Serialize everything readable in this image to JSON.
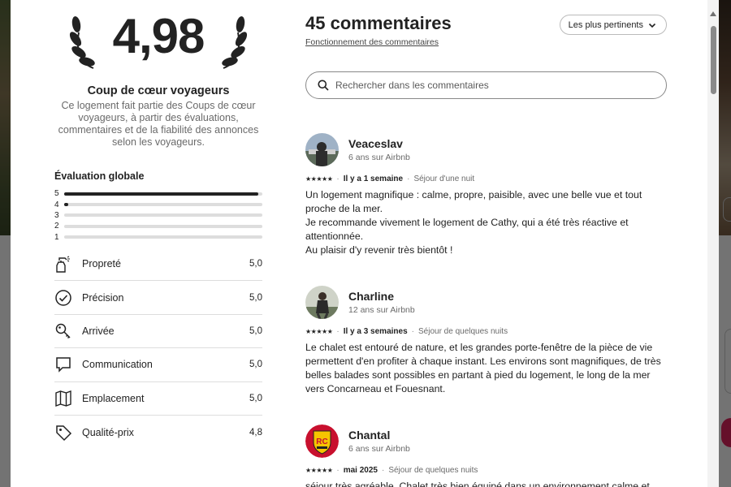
{
  "hero": {
    "score": "4,98",
    "title": "Coup de cœur voyageurs",
    "description": "Ce logement fait partie des Coups de cœur voyageurs, à partir des évaluations, commentaires et de la fiabilité des annonces selon les voyageurs."
  },
  "overall": {
    "title": "Évaluation globale",
    "distribution": [
      {
        "stars": "5",
        "fraction": 0.98
      },
      {
        "stars": "4",
        "fraction": 0.02
      },
      {
        "stars": "3",
        "fraction": 0
      },
      {
        "stars": "2",
        "fraction": 0
      },
      {
        "stars": "1",
        "fraction": 0
      }
    ]
  },
  "categories": [
    {
      "label": "Propreté",
      "value": "5,0",
      "icon": "spray-bottle-icon"
    },
    {
      "label": "Précision",
      "value": "5,0",
      "icon": "check-circle-icon"
    },
    {
      "label": "Arrivée",
      "value": "5,0",
      "icon": "key-icon"
    },
    {
      "label": "Communication",
      "value": "5,0",
      "icon": "chat-bubble-icon"
    },
    {
      "label": "Emplacement",
      "value": "5,0",
      "icon": "map-icon"
    },
    {
      "label": "Qualité-prix",
      "value": "4,8",
      "icon": "tag-icon"
    }
  ],
  "reviews_header": {
    "count_title": "45 commentaires",
    "how_link": "Fonctionnement des commentaires",
    "sort_label": "Les plus pertinents",
    "search_placeholder": "Rechercher dans les commentaires"
  },
  "reviews": [
    {
      "name": "Veaceslav",
      "meta": "6 ans sur Airbnb",
      "stars": "★★★★★",
      "date": "Il y a 1 semaine",
      "stay": "Séjour d'une nuit",
      "text": "Un logement magnifique : calme, propre, paisible, avec une belle vue et tout proche de la mer.\nJe recommande vivement le logement de Cathy, qui a été très réactive et attentionnée.\nAu plaisir d'y revenir très bientôt !"
    },
    {
      "name": "Charline",
      "meta": "12 ans sur Airbnb",
      "stars": "★★★★★",
      "date": "Il y a 3 semaines",
      "stay": "Séjour de quelques nuits",
      "text": "Le chalet est entouré de nature, et les grandes porte-fenêtre de la pièce de vie permettent d'en profiter à chaque instant. Les environs sont magnifiques, de très belles balades sont possibles en partant à pied du logement, le long de la mer vers Concarneau et Fouesnant."
    },
    {
      "name": "Chantal",
      "meta": "6 ans sur Airbnb",
      "stars": "★★★★★",
      "date": "mai 2025",
      "stay": "Séjour de quelques nuits",
      "text": "séjour très agréable. Chalet très bien équipé dans un environnement calme et bien fleuri. Tout était parfait : propre, bien décoré et extrêmement confortable."
    }
  ],
  "colors": {
    "text": "#222222",
    "muted": "#6a6a6a",
    "divider": "#dddddd",
    "accent_pink": "#e0245e"
  }
}
